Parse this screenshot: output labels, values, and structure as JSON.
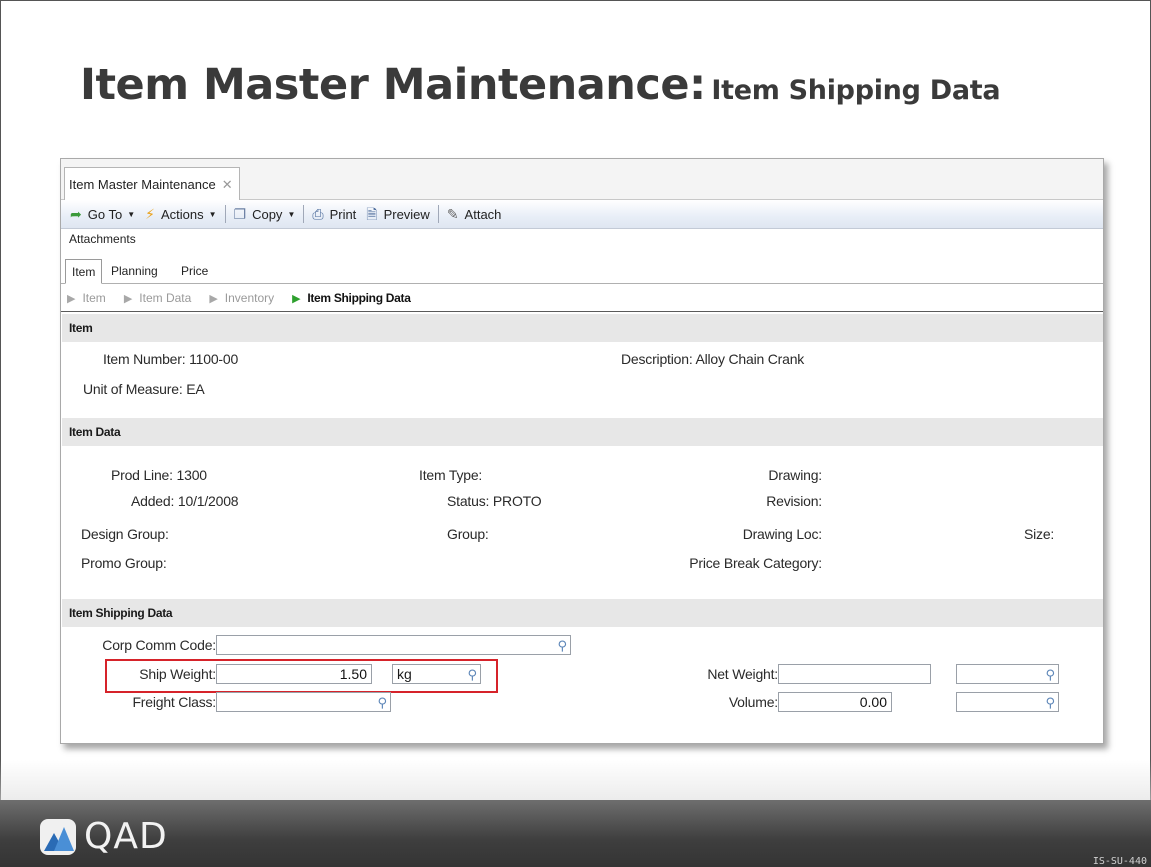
{
  "slide": {
    "title_main": "Item Master Maintenance:",
    "title_sub": "Item Shipping Data",
    "code": "IS-SU-440"
  },
  "window": {
    "tab_label": "Item Master Maintenance",
    "tab_close": "✕",
    "toolbar": {
      "goto": "Go To",
      "actions": "Actions",
      "copy": "Copy",
      "print": "Print",
      "preview": "Preview",
      "attach": "Attach"
    },
    "attachments": "Attachments",
    "tabs": [
      "Item",
      "Planning",
      "Price"
    ],
    "breadcrumb": [
      "Item",
      "Item Data",
      "Inventory",
      "Item Shipping Data"
    ]
  },
  "sections": {
    "item": {
      "title": "Item",
      "item_number_label": "Item Number:",
      "item_number": "1100-00",
      "description_label": "Description:",
      "description": "Alloy Chain Crank",
      "uom_label": "Unit of Measure:",
      "uom": "EA"
    },
    "item_data": {
      "title": "Item Data",
      "prod_line_label": "Prod Line:",
      "prod_line": "1300",
      "item_type_label": "Item Type:",
      "drawing_label": "Drawing:",
      "added_label": "Added:",
      "added": "10/1/2008",
      "status_label": "Status:",
      "status": "PROTO",
      "revision_label": "Revision:",
      "design_group_label": "Design Group:",
      "group_label": "Group:",
      "drawing_loc_label": "Drawing Loc:",
      "size_label": "Size:",
      "promo_group_label": "Promo Group:",
      "price_break_label": "Price Break Category:"
    },
    "shipping": {
      "title": "Item Shipping Data",
      "corp_comm_label": "Corp Comm Code:",
      "corp_comm_value": "",
      "ship_weight_label": "Ship Weight:",
      "ship_weight_value": "1.50",
      "ship_weight_uom": "kg",
      "freight_class_label": "Freight Class:",
      "freight_class_value": "",
      "net_weight_label": "Net Weight:",
      "net_weight_value": "",
      "net_weight_uom": "",
      "volume_label": "Volume:",
      "volume_value": "0.00",
      "volume_uom": ""
    }
  },
  "colors": {
    "highlight": "#d6232a",
    "section_bg": "#e7e7e7",
    "active_arrow": "#2ea02e"
  },
  "logo": {
    "text": "QAD"
  }
}
